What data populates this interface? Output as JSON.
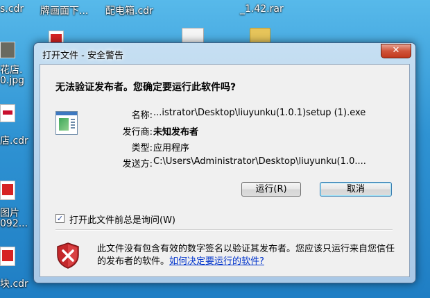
{
  "desktop": {
    "labels": [
      "s.cdr",
      "牌画面下...",
      "配电箱.cdr",
      "_1.42.rar",
      "花店.",
      "0.jpg",
      "店.cdr",
      "图片",
      "092...",
      "块.cdr"
    ]
  },
  "dialog": {
    "title": "打开文件 - 安全警告",
    "close_label": "✕",
    "headline": "无法验证发布者。您确定要运行此软件吗?",
    "fields": {
      "name_label": "名称:",
      "name_value": "...istrator\\Desktop\\liuyunku(1.0.1)setup (1).exe",
      "publisher_label": "发行商:",
      "publisher_value": "未知发布者",
      "type_label": "类型:",
      "type_value": "应用程序",
      "from_label": "发送方:",
      "from_value": "C:\\Users\\Administrator\\Desktop\\liuyunku(1.0...."
    },
    "run_button": "运行(R)",
    "cancel_button": "取消",
    "checkbox_label": "打开此文件前总是询问(W)",
    "checkbox_checked": true,
    "warning_text": "此文件没有包含有效的数字签名以验证其发布者。您应该只运行来自您信任的发布者的软件。",
    "warning_link": "如何决定要运行的软件?"
  }
}
